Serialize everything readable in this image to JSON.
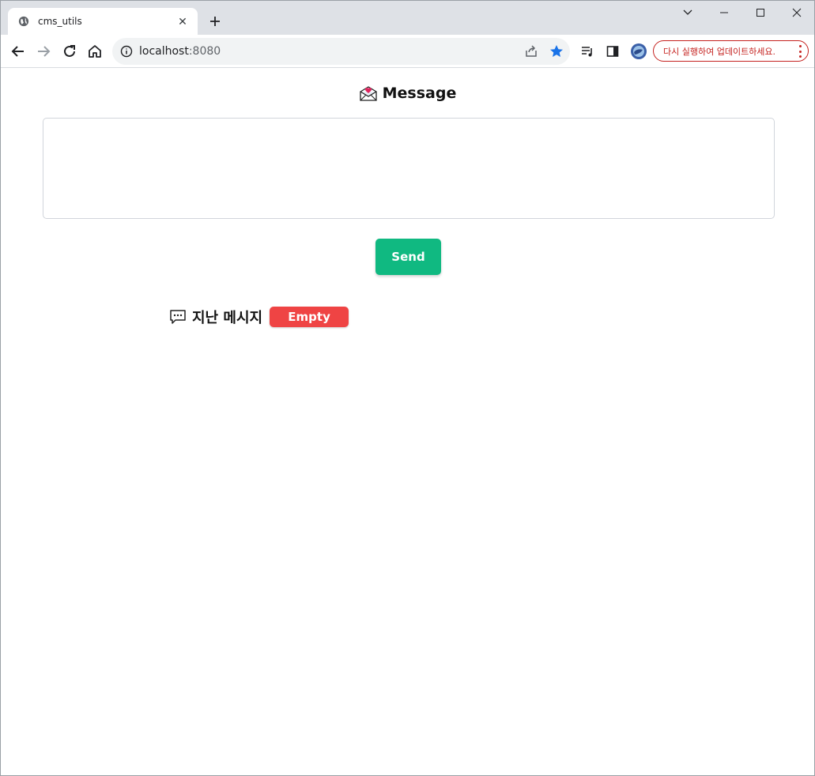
{
  "browser": {
    "tab_title": "cms_utils",
    "url_host": "localhost",
    "url_port": ":8080",
    "update_button_label": "다시 실행하여 업데이트하세요."
  },
  "page": {
    "heading": "Message",
    "message_placeholder": "",
    "send_label": "Send",
    "history_title": "지난 메시지",
    "history_status": "Empty"
  },
  "colors": {
    "send_button": "#10b981",
    "empty_badge": "#ef4444",
    "update_accent": "#c5221f",
    "bookmark_star": "#1a73e8"
  },
  "icons": {
    "heading": "love-letter-icon",
    "history": "chat-bubble-icon"
  }
}
